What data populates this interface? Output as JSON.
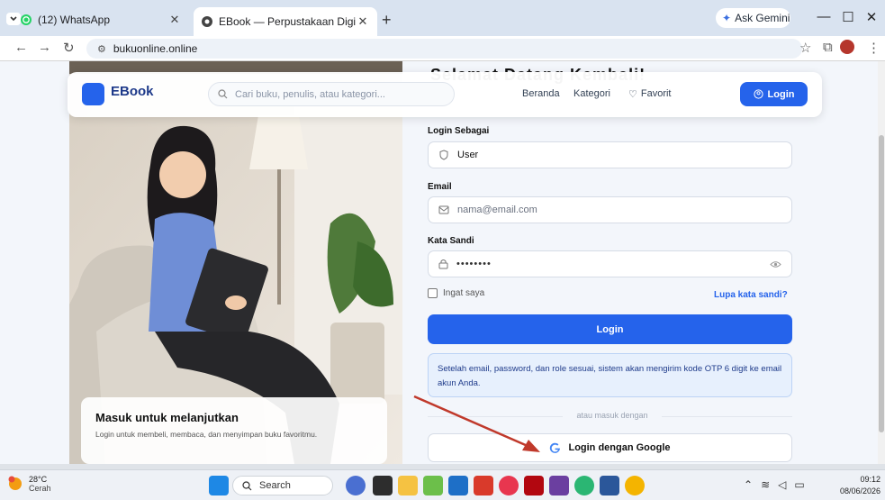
{
  "browser": {
    "tabs": [
      {
        "title": "(12) WhatsApp",
        "icon": "whatsapp-icon"
      },
      {
        "title": "EBook — Perpustakaan Digital",
        "icon": "site-icon"
      }
    ],
    "new_tab": "+",
    "gemini_label": "Ask Gemini",
    "url": "bukuonline.online"
  },
  "nav": {
    "brand": "EBook",
    "search_placeholder": "Cari buku, penulis, atau kategori...",
    "links": [
      "Beranda",
      "Kategori",
      "Favorit"
    ],
    "login_label": "Login"
  },
  "form": {
    "headline": "Selamat Datang Kembali!",
    "role_label": "Login Sebagai",
    "role_value": "User",
    "email_label": "Email",
    "email_placeholder": "nama@email.com",
    "password_label": "Kata Sandi",
    "password_value": "••••••••",
    "remember_label": "Ingat saya",
    "forgot_label": "Lupa kata sandi?",
    "submit_label": "Login",
    "info_text": "Setelah email, password, dan role sesuai, sistem akan mengirim kode OTP 6 digit ke email akun Anda.",
    "divider_text": "atau masuk dengan",
    "google_label": "Login dengan Google"
  },
  "hero": {
    "title": "Masuk untuk melanjutkan",
    "subtitle": "Login untuk membeli, membaca, dan menyimpan buku favoritmu."
  },
  "taskbar": {
    "temperature": "28°C",
    "condition": "Cerah",
    "search_label": "Search",
    "time": "09:12",
    "date": "08/06/2026"
  },
  "colors": {
    "accent": "#2563eb",
    "annotation_arrow": "#c0392b"
  }
}
